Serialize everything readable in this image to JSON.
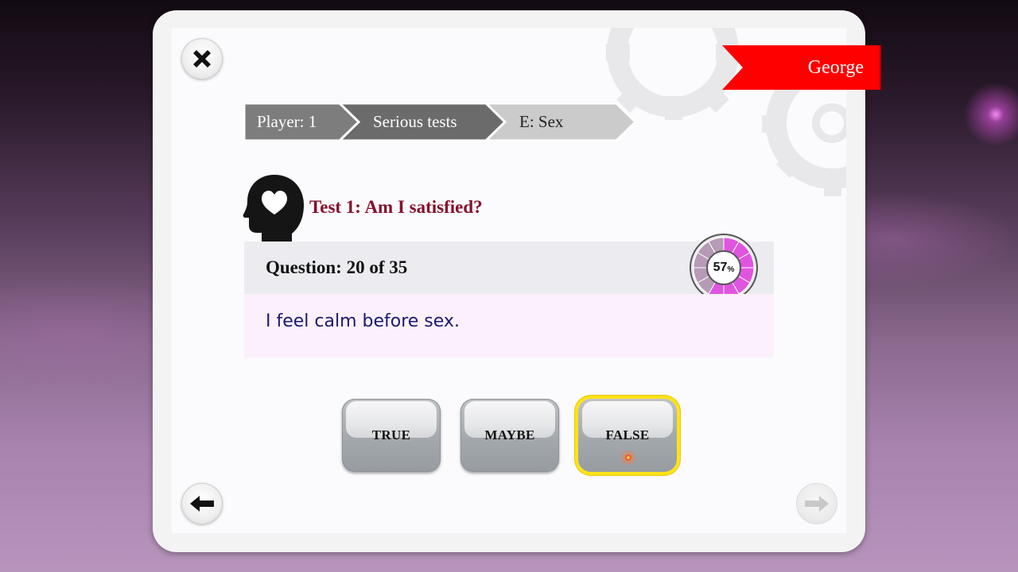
{
  "player_ribbon": {
    "name": "George",
    "color": "#ff0000"
  },
  "breadcrumb": {
    "items": [
      {
        "label": "Player: 1"
      },
      {
        "label": "Serious tests"
      },
      {
        "label": "E: Sex"
      }
    ]
  },
  "test": {
    "title": "Test 1: Am I satisfied?",
    "question_label": "Question: 20 of 35",
    "question_text": "I feel calm before sex.",
    "progress": {
      "value": "57",
      "unit": "%"
    }
  },
  "answers": [
    {
      "label": "TRUE",
      "selected": false
    },
    {
      "label": "MAYBE",
      "selected": false
    },
    {
      "label": "FALSE",
      "selected": true
    }
  ],
  "icons": {
    "close": "close-icon",
    "back": "arrow-left-icon",
    "next": "arrow-right-icon",
    "head": "head-heart-icon"
  },
  "colors": {
    "title": "#86112c",
    "question_text": "#1a1a6e",
    "progress_fill": "#e055e0",
    "selected_outline": "#ffe21a"
  }
}
